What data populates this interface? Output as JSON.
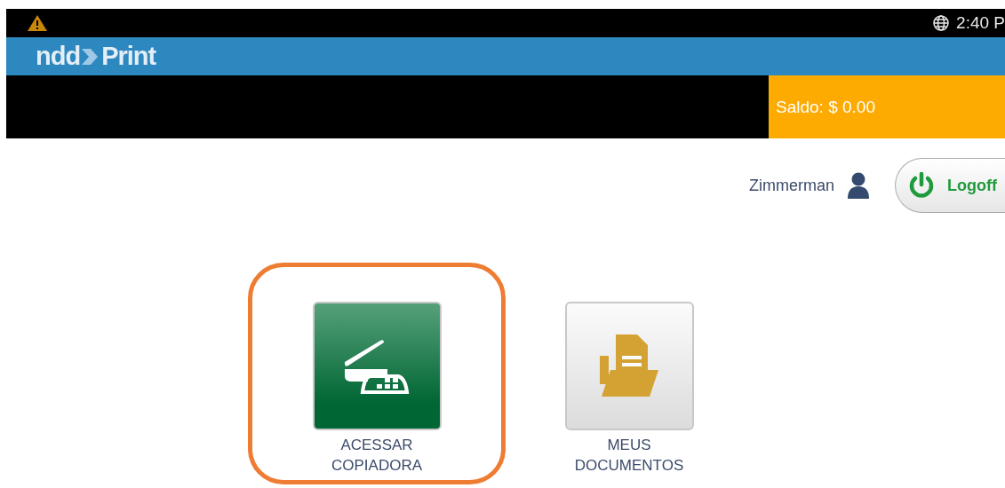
{
  "status_bar": {
    "time": "2:40 P"
  },
  "header": {
    "logo_left": "ndd",
    "logo_right": "Print"
  },
  "balance": {
    "label": "Saldo: $ 0.00"
  },
  "user": {
    "name": "Zimmerman"
  },
  "logoff": {
    "label": "Logoff"
  },
  "tiles": [
    {
      "kind": "copier",
      "line1": "ACESSAR",
      "line2": "COPIADORA",
      "selected": true
    },
    {
      "kind": "documents",
      "line1": "MEUS",
      "line2": "DOCUMENTOS",
      "selected": false
    }
  ]
}
